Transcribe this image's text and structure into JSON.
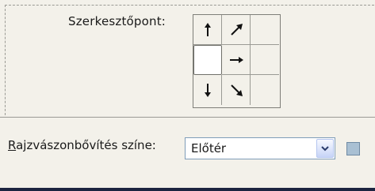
{
  "anchor": {
    "label": "Szerkesztőpont:",
    "cells": [
      {
        "icon": "arrow-up-icon"
      },
      {
        "icon": "arrow-up-right-icon"
      },
      {
        "icon": "empty"
      },
      {
        "icon": "selected-anchor"
      },
      {
        "icon": "arrow-right-icon"
      },
      {
        "icon": "empty"
      },
      {
        "icon": "arrow-down-icon"
      },
      {
        "icon": "arrow-down-right-icon"
      },
      {
        "icon": "empty"
      }
    ]
  },
  "extension": {
    "label_first": "R",
    "label_rest": "ajzvászonbővítés színe:",
    "select_value": "Előtér",
    "swatch_color": "#a9c0d3"
  }
}
